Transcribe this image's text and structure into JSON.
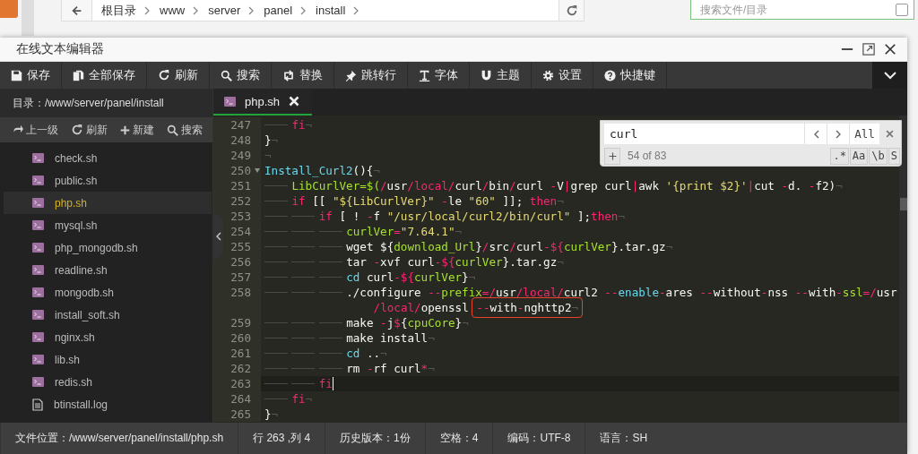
{
  "file_manager": {
    "breadcrumb": [
      "根目录",
      "www",
      "server",
      "panel",
      "install"
    ],
    "search": {
      "placeholder": "搜索文件/目录",
      "checked": false
    }
  },
  "window": {
    "title": "在线文本编辑器"
  },
  "toolbar": [
    "保存",
    "全部保存",
    "刷新",
    "搜索",
    "替换",
    "跳转行",
    "字体",
    "主题",
    "设置",
    "快捷键"
  ],
  "sidebar": {
    "directory": "目录：/www/server/panel/install",
    "actions": [
      "上一级",
      "刷新",
      "新建",
      "搜索"
    ],
    "files": [
      {
        "name": "check.sh",
        "kind": "script",
        "selected": false
      },
      {
        "name": "public.sh",
        "kind": "script",
        "selected": false
      },
      {
        "name": "php.sh",
        "kind": "script",
        "selected": true
      },
      {
        "name": "mysql.sh",
        "kind": "script",
        "selected": false
      },
      {
        "name": "php_mongodb.sh",
        "kind": "script",
        "selected": false
      },
      {
        "name": "readline.sh",
        "kind": "script",
        "selected": false
      },
      {
        "name": "mongodb.sh",
        "kind": "script",
        "selected": false
      },
      {
        "name": "install_soft.sh",
        "kind": "script",
        "selected": false
      },
      {
        "name": "nginx.sh",
        "kind": "script",
        "selected": false
      },
      {
        "name": "lib.sh",
        "kind": "script",
        "selected": false
      },
      {
        "name": "redis.sh",
        "kind": "script",
        "selected": false
      },
      {
        "name": "btinstall.log",
        "kind": "log",
        "selected": false
      }
    ]
  },
  "tabs": [
    {
      "label": "php.sh",
      "selected": true
    }
  ],
  "editor": {
    "lines": [
      {
        "number": "247",
        "foldable": false,
        "current": false,
        "segments": [
          {
            "kind": "tab"
          },
          {
            "kind": "keyword",
            "text": "fi"
          },
          {
            "kind": "eol",
            "text": "¬"
          }
        ]
      },
      {
        "number": "248",
        "foldable": false,
        "current": false,
        "segments": [
          {
            "kind": "plain",
            "text": "}"
          },
          {
            "kind": "eol",
            "text": "¬"
          }
        ]
      },
      {
        "number": "249",
        "foldable": false,
        "current": false,
        "segments": [
          {
            "kind": "eol",
            "text": "¬"
          }
        ]
      },
      {
        "number": "250",
        "foldable": true,
        "current": false,
        "segments": [
          {
            "kind": "builtin",
            "text": "Install_Curl2"
          },
          {
            "kind": "plain",
            "text": "(){"
          },
          {
            "kind": "eol",
            "text": "¬"
          }
        ]
      },
      {
        "number": "251",
        "foldable": false,
        "current": false,
        "segments": [
          {
            "kind": "tab"
          },
          {
            "kind": "variable",
            "text": "LibCurlVer=$("
          },
          {
            "kind": "keyword",
            "text": "/"
          },
          {
            "kind": "plain",
            "text": "usr"
          },
          {
            "kind": "keyword",
            "text": "/local/"
          },
          {
            "kind": "plain",
            "text": "curl"
          },
          {
            "kind": "keyword",
            "text": "/"
          },
          {
            "kind": "plain",
            "text": "bin"
          },
          {
            "kind": "keyword",
            "text": "/"
          },
          {
            "kind": "plain",
            "text": "curl "
          },
          {
            "kind": "keyword",
            "text": "-"
          },
          {
            "kind": "plain",
            "text": "V"
          },
          {
            "kind": "keyword",
            "text": "|"
          },
          {
            "kind": "plain",
            "text": "grep curl"
          },
          {
            "kind": "keyword",
            "text": "|"
          },
          {
            "kind": "plain",
            "text": "awk "
          },
          {
            "kind": "string",
            "text": "'{print $2}'"
          },
          {
            "kind": "keyword",
            "text": "|"
          },
          {
            "kind": "plain",
            "text": "cut "
          },
          {
            "kind": "keyword",
            "text": "-"
          },
          {
            "kind": "plain",
            "text": "d. "
          },
          {
            "kind": "keyword",
            "text": "-"
          },
          {
            "kind": "plain",
            "text": "f2)"
          },
          {
            "kind": "eol",
            "text": "¬"
          }
        ]
      },
      {
        "number": "252",
        "foldable": false,
        "current": false,
        "segments": [
          {
            "kind": "tab"
          },
          {
            "kind": "keyword",
            "text": "if"
          },
          {
            "kind": "plain",
            "text": " [[ "
          },
          {
            "kind": "string",
            "text": "\"${LibCurlVer}\""
          },
          {
            "kind": "keyword",
            "text": " -"
          },
          {
            "kind": "plain",
            "text": "le "
          },
          {
            "kind": "string",
            "text": "\"60\""
          },
          {
            "kind": "plain",
            "text": " ]]; "
          },
          {
            "kind": "keyword",
            "text": "then"
          },
          {
            "kind": "eol",
            "text": "¬"
          }
        ]
      },
      {
        "number": "253",
        "foldable": false,
        "current": false,
        "segments": [
          {
            "kind": "tab"
          },
          {
            "kind": "tab"
          },
          {
            "kind": "keyword",
            "text": "if"
          },
          {
            "kind": "plain",
            "text": " [ ! "
          },
          {
            "kind": "keyword",
            "text": "-"
          },
          {
            "kind": "plain",
            "text": "f "
          },
          {
            "kind": "string",
            "text": "\"/usr/local/curl2/bin/curl\""
          },
          {
            "kind": "plain",
            "text": " ];"
          },
          {
            "kind": "keyword",
            "text": "then"
          },
          {
            "kind": "eol",
            "text": "¬"
          }
        ]
      },
      {
        "number": "254",
        "foldable": false,
        "current": false,
        "segments": [
          {
            "kind": "tab"
          },
          {
            "kind": "tab"
          },
          {
            "kind": "tab"
          },
          {
            "kind": "variable",
            "text": "curlVer"
          },
          {
            "kind": "keyword",
            "text": "="
          },
          {
            "kind": "string",
            "text": "\"7.64.1\""
          },
          {
            "kind": "eol",
            "text": "¬"
          }
        ]
      },
      {
        "number": "255",
        "foldable": false,
        "current": false,
        "segments": [
          {
            "kind": "tab"
          },
          {
            "kind": "tab"
          },
          {
            "kind": "tab"
          },
          {
            "kind": "plain",
            "text": "wget ${"
          },
          {
            "kind": "variable",
            "text": "download_Url"
          },
          {
            "kind": "plain",
            "text": "}"
          },
          {
            "kind": "keyword",
            "text": "/"
          },
          {
            "kind": "plain",
            "text": "src"
          },
          {
            "kind": "keyword",
            "text": "/"
          },
          {
            "kind": "plain",
            "text": "curl"
          },
          {
            "kind": "keyword",
            "text": "-${"
          },
          {
            "kind": "variable",
            "text": "curlVer"
          },
          {
            "kind": "plain",
            "text": "}.tar.gz"
          },
          {
            "kind": "eol",
            "text": "¬"
          }
        ]
      },
      {
        "number": "256",
        "foldable": false,
        "current": false,
        "segments": [
          {
            "kind": "tab"
          },
          {
            "kind": "tab"
          },
          {
            "kind": "tab"
          },
          {
            "kind": "plain",
            "text": "tar "
          },
          {
            "kind": "keyword",
            "text": "-"
          },
          {
            "kind": "plain",
            "text": "xvf curl"
          },
          {
            "kind": "keyword",
            "text": "-${"
          },
          {
            "kind": "variable",
            "text": "curlVer"
          },
          {
            "kind": "plain",
            "text": "}.tar.gz"
          },
          {
            "kind": "eol",
            "text": "¬"
          }
        ]
      },
      {
        "number": "257",
        "foldable": false,
        "current": false,
        "segments": [
          {
            "kind": "tab"
          },
          {
            "kind": "tab"
          },
          {
            "kind": "tab"
          },
          {
            "kind": "builtin",
            "text": "cd"
          },
          {
            "kind": "plain",
            "text": " curl"
          },
          {
            "kind": "keyword",
            "text": "-${"
          },
          {
            "kind": "variable",
            "text": "curlVer"
          },
          {
            "kind": "plain",
            "text": "}"
          },
          {
            "kind": "eol",
            "text": "¬"
          }
        ]
      },
      {
        "number": "258",
        "foldable": false,
        "current": false,
        "segments": [
          {
            "kind": "tab"
          },
          {
            "kind": "tab"
          },
          {
            "kind": "tab"
          },
          {
            "kind": "plain",
            "text": "./configure "
          },
          {
            "kind": "keyword",
            "text": "--"
          },
          {
            "kind": "variable",
            "text": "prefix"
          },
          {
            "kind": "keyword",
            "text": "=/"
          },
          {
            "kind": "plain",
            "text": "usr"
          },
          {
            "kind": "keyword",
            "text": "/local/"
          },
          {
            "kind": "plain",
            "text": "curl2 "
          },
          {
            "kind": "keyword",
            "text": "--"
          },
          {
            "kind": "builtin",
            "text": "enable"
          },
          {
            "kind": "keyword",
            "text": "-"
          },
          {
            "kind": "plain",
            "text": "ares "
          },
          {
            "kind": "keyword",
            "text": "--"
          },
          {
            "kind": "plain",
            "text": "without"
          },
          {
            "kind": "keyword",
            "text": "-"
          },
          {
            "kind": "plain",
            "text": "nss "
          },
          {
            "kind": "keyword",
            "text": "--"
          },
          {
            "kind": "plain",
            "text": "with"
          },
          {
            "kind": "keyword",
            "text": "-"
          },
          {
            "kind": "variable",
            "text": "ssl"
          },
          {
            "kind": "keyword",
            "text": "=/"
          },
          {
            "kind": "plain",
            "text": "usr"
          }
        ],
        "wrap": [
          {
            "kind": "keyword",
            "text": "/local/"
          },
          {
            "kind": "plain",
            "text": "openssl "
          },
          {
            "kind": "keyword",
            "text": "--",
            "boxed": true
          },
          {
            "kind": "plain",
            "text": "with",
            "boxed": true
          },
          {
            "kind": "keyword",
            "text": "-",
            "boxed": true
          },
          {
            "kind": "plain",
            "text": "nghttp2",
            "boxed": true
          },
          {
            "kind": "eol",
            "text": "¬",
            "boxed": true
          }
        ]
      },
      {
        "number": "259",
        "foldable": false,
        "current": false,
        "segments": [
          {
            "kind": "tab"
          },
          {
            "kind": "tab"
          },
          {
            "kind": "tab"
          },
          {
            "kind": "plain",
            "text": "make "
          },
          {
            "kind": "keyword",
            "text": "-"
          },
          {
            "kind": "plain",
            "text": "j"
          },
          {
            "kind": "keyword",
            "text": "$"
          },
          {
            "kind": "plain",
            "text": "{"
          },
          {
            "kind": "variable",
            "text": "cpuCore"
          },
          {
            "kind": "plain",
            "text": "}"
          },
          {
            "kind": "eol",
            "text": "¬"
          }
        ]
      },
      {
        "number": "260",
        "foldable": false,
        "current": false,
        "segments": [
          {
            "kind": "tab"
          },
          {
            "kind": "tab"
          },
          {
            "kind": "tab"
          },
          {
            "kind": "plain",
            "text": "make install"
          },
          {
            "kind": "eol",
            "text": "¬"
          }
        ]
      },
      {
        "number": "261",
        "foldable": false,
        "current": false,
        "segments": [
          {
            "kind": "tab"
          },
          {
            "kind": "tab"
          },
          {
            "kind": "tab"
          },
          {
            "kind": "builtin",
            "text": "cd"
          },
          {
            "kind": "plain",
            "text": " .."
          },
          {
            "kind": "eol",
            "text": "¬"
          }
        ]
      },
      {
        "number": "262",
        "foldable": false,
        "current": false,
        "segments": [
          {
            "kind": "tab"
          },
          {
            "kind": "tab"
          },
          {
            "kind": "tab"
          },
          {
            "kind": "plain",
            "text": "rm "
          },
          {
            "kind": "keyword",
            "text": "-"
          },
          {
            "kind": "plain",
            "text": "rf curl"
          },
          {
            "kind": "keyword",
            "text": "*"
          },
          {
            "kind": "eol",
            "text": "¬"
          }
        ]
      },
      {
        "number": "263",
        "foldable": false,
        "current": true,
        "segments": [
          {
            "kind": "tab"
          },
          {
            "kind": "tab"
          },
          {
            "kind": "keyword",
            "text": "fi"
          }
        ]
      },
      {
        "number": "264",
        "foldable": false,
        "current": false,
        "segments": [
          {
            "kind": "tab"
          },
          {
            "kind": "keyword",
            "text": "fi"
          },
          {
            "kind": "eol",
            "text": "¬"
          }
        ]
      },
      {
        "number": "265",
        "foldable": false,
        "current": false,
        "segments": [
          {
            "kind": "plain",
            "text": "}"
          },
          {
            "kind": "eol",
            "text": "¬"
          }
        ]
      }
    ]
  },
  "find": {
    "query": "curl",
    "all_label": "All",
    "count": "54 of 83",
    "options": [
      ".*",
      "Aa",
      "\\b",
      "S"
    ]
  },
  "status_bar": [
    "文件位置：/www/server/panel/install/php.sh",
    "行 263 ,列 4",
    "历史版本：1份",
    "空格：4",
    "编码：UTF-8",
    "语言：SH"
  ]
}
